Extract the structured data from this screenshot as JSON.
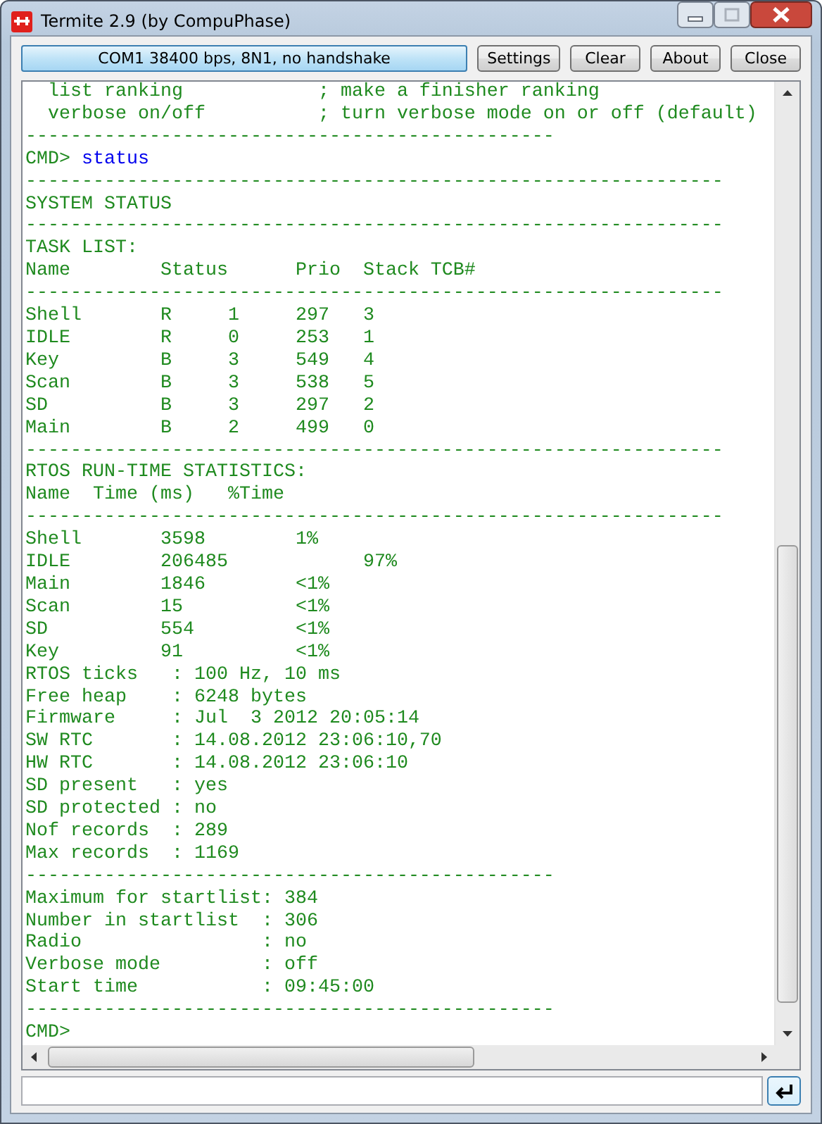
{
  "window": {
    "title": "Termite 2.9 (by CompuPhase)"
  },
  "connection_button": "COM1 38400 bps, 8N1, no handshake",
  "buttons": [
    "Settings",
    "Clear",
    "About",
    "Close"
  ],
  "terminal": {
    "lines": [
      {
        "kind": "output",
        "text": "  list ranking            ; make a finisher ranking"
      },
      {
        "kind": "output",
        "text": "  verbose on/off          ; turn verbose mode on or off (default)"
      },
      {
        "kind": "output",
        "text": "-----------------------------------------------"
      },
      {
        "kind": "command",
        "prompt": "CMD> ",
        "command": "status"
      },
      {
        "kind": "output",
        "text": "--------------------------------------------------------------"
      },
      {
        "kind": "output",
        "text": "SYSTEM STATUS"
      },
      {
        "kind": "output",
        "text": "--------------------------------------------------------------"
      },
      {
        "kind": "output",
        "text": "TASK LIST:"
      },
      {
        "kind": "output",
        "text": "Name        Status      Prio  Stack TCB#"
      },
      {
        "kind": "output",
        "text": "--------------------------------------------------------------"
      },
      {
        "kind": "output",
        "text": "Shell       R     1     297   3"
      },
      {
        "kind": "output",
        "text": "IDLE        R     0     253   1"
      },
      {
        "kind": "output",
        "text": "Key         B     3     549   4"
      },
      {
        "kind": "output",
        "text": "Scan        B     3     538   5"
      },
      {
        "kind": "output",
        "text": "SD          B     3     297   2"
      },
      {
        "kind": "output",
        "text": "Main        B     2     499   0"
      },
      {
        "kind": "output",
        "text": "--------------------------------------------------------------"
      },
      {
        "kind": "output",
        "text": "RTOS RUN-TIME STATISTICS:"
      },
      {
        "kind": "output",
        "text": "Name  Time (ms)   %Time"
      },
      {
        "kind": "output",
        "text": "--------------------------------------------------------------"
      },
      {
        "kind": "output",
        "text": "Shell       3598        1%"
      },
      {
        "kind": "output",
        "text": "IDLE        206485            97%"
      },
      {
        "kind": "output",
        "text": "Main        1846        <1%"
      },
      {
        "kind": "output",
        "text": "Scan        15          <1%"
      },
      {
        "kind": "output",
        "text": "SD          554         <1%"
      },
      {
        "kind": "output",
        "text": "Key         91          <1%"
      },
      {
        "kind": "output",
        "text": "RTOS ticks   : 100 Hz, 10 ms"
      },
      {
        "kind": "output",
        "text": "Free heap    : 6248 bytes"
      },
      {
        "kind": "output",
        "text": "Firmware     : Jul  3 2012 20:05:14"
      },
      {
        "kind": "output",
        "text": "SW RTC       : 14.08.2012 23:06:10,70"
      },
      {
        "kind": "output",
        "text": "HW RTC       : 14.08.2012 23:06:10"
      },
      {
        "kind": "output",
        "text": "SD present   : yes"
      },
      {
        "kind": "output",
        "text": "SD protected : no"
      },
      {
        "kind": "output",
        "text": "Nof records  : 289"
      },
      {
        "kind": "output",
        "text": "Max records  : 1169"
      },
      {
        "kind": "output",
        "text": "-----------------------------------------------"
      },
      {
        "kind": "output",
        "text": "Maximum for startlist: 384"
      },
      {
        "kind": "output",
        "text": "Number in startlist  : 306"
      },
      {
        "kind": "output",
        "text": "Radio                : no"
      },
      {
        "kind": "output",
        "text": "Verbose mode         : off"
      },
      {
        "kind": "output",
        "text": "Start time           : 09:45:00"
      },
      {
        "kind": "output",
        "text": "-----------------------------------------------"
      },
      {
        "kind": "output",
        "text": "CMD>"
      }
    ]
  }
}
